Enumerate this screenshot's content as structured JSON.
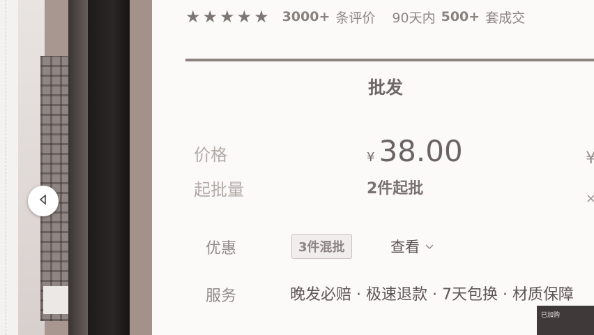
{
  "rating": {
    "stars": 5,
    "review_count": "3000+",
    "review_suffix": "条评价",
    "period_prefix": "90天内",
    "deal_count": "500+",
    "deal_suffix": "套成交"
  },
  "section": {
    "title": "批发"
  },
  "price": {
    "label": "价格",
    "currency": "¥",
    "value": "38.00"
  },
  "moq": {
    "label": "起批量",
    "value": "2件起批"
  },
  "promo": {
    "label": "优惠",
    "tag": "3件混批",
    "view_label": "查看"
  },
  "service": {
    "label": "服务",
    "items": "晚发必赔 · 极速退款 · 7天包换 · 材质保障"
  },
  "toast": {
    "text": "已加购"
  },
  "colors": {
    "accent": "#8c8280",
    "price": "#6c6462"
  }
}
